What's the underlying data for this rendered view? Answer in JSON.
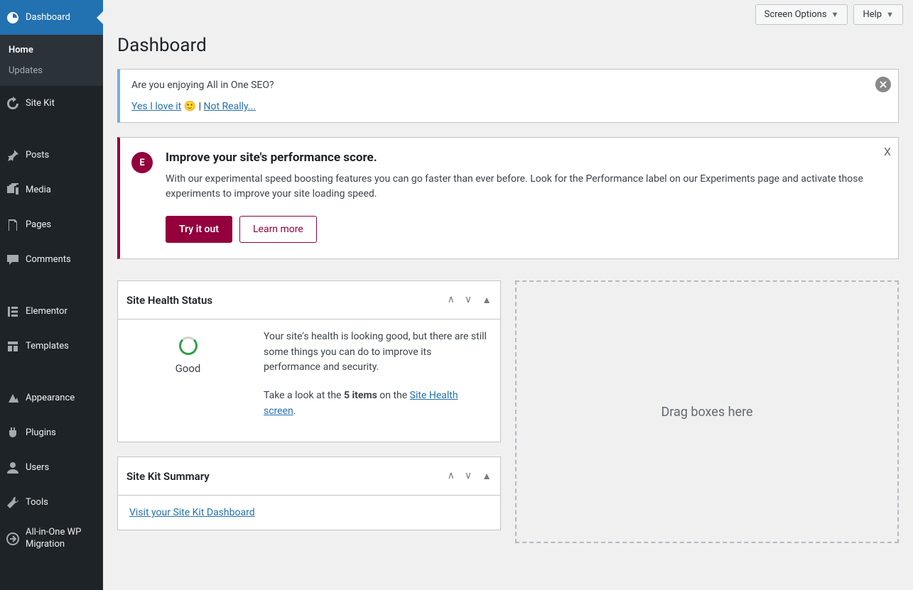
{
  "topbar": {
    "screen_options": "Screen Options",
    "help": "Help"
  },
  "page_title": "Dashboard",
  "sidebar": {
    "items": [
      {
        "label": "Dashboard",
        "icon": "dashboard"
      },
      {
        "label": "Site Kit",
        "icon": "sitekit"
      },
      {
        "label": "Posts",
        "icon": "pin"
      },
      {
        "label": "Media",
        "icon": "media"
      },
      {
        "label": "Pages",
        "icon": "page"
      },
      {
        "label": "Comments",
        "icon": "comment"
      },
      {
        "label": "Elementor",
        "icon": "elementor"
      },
      {
        "label": "Templates",
        "icon": "templates"
      },
      {
        "label": "Appearance",
        "icon": "appearance"
      },
      {
        "label": "Plugins",
        "icon": "plugins"
      },
      {
        "label": "Users",
        "icon": "users"
      },
      {
        "label": "Tools",
        "icon": "tools"
      },
      {
        "label": "All-in-One WP Migration",
        "icon": "migration"
      }
    ],
    "submenu": [
      {
        "label": "Home",
        "current": true
      },
      {
        "label": "Updates",
        "current": false
      }
    ]
  },
  "seo_notice": {
    "question": "Are you enjoying All in One SEO?",
    "yes": "Yes I love it",
    "emoji": "🙂",
    "sep": " | ",
    "no": "Not Really..."
  },
  "elementor_notice": {
    "badge": "E",
    "title": "Improve your site's performance score.",
    "desc": "With our experimental speed boosting features you can go faster than ever before. Look for the Performance label on our Experiments page and activate those experiments to improve your site loading speed.",
    "primary": "Try it out",
    "secondary": "Learn more",
    "close": "X"
  },
  "site_health": {
    "title": "Site Health Status",
    "status": "Good",
    "p1": "Your site's health is looking good, but there are still some things you can do to improve its performance and security.",
    "p2a": "Take a look at the ",
    "p2b": "5 items",
    "p2c": " on the ",
    "link": "Site Health screen",
    "dot": "."
  },
  "sitekit_box": {
    "title": "Site Kit Summary",
    "link": "Visit your Site Kit Dashboard"
  },
  "drop_zone": "Drag boxes here"
}
